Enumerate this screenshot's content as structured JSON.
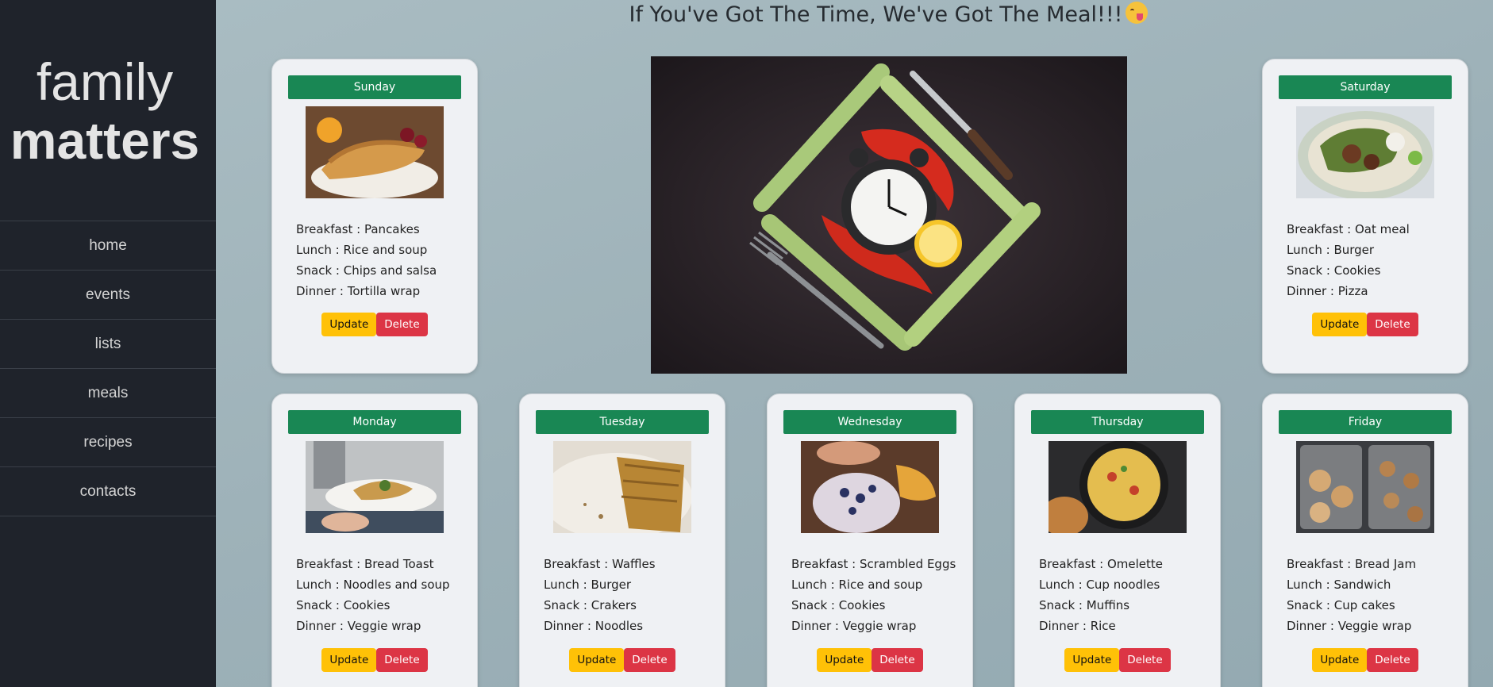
{
  "logo": {
    "line1": "family",
    "line2": "matters"
  },
  "nav": [
    "home",
    "events",
    "lists",
    "meals",
    "recipes",
    "contacts"
  ],
  "headline": "If You've Got The Time, We've Got The Meal!!!",
  "buttons": {
    "update": "Update",
    "delete": "Delete"
  },
  "days": [
    {
      "day": "Sunday",
      "image": "pancakes-photo",
      "breakfast": "Breakfast : Pancakes",
      "lunch": "Lunch : Rice and soup",
      "snack": "Snack : Chips and salsa",
      "dinner": "Dinner : Tortilla wrap"
    },
    {
      "day": "Saturday",
      "image": "oatmeal-bowl-photo",
      "breakfast": "Breakfast : Oat meal",
      "lunch": "Lunch : Burger",
      "snack": "Snack : Cookies",
      "dinner": "Dinner : Pizza"
    },
    {
      "day": "Monday",
      "image": "toast-plate-photo",
      "breakfast": "Breakfast : Bread Toast",
      "lunch": "Lunch : Noodles and soup",
      "snack": "Snack : Cookies",
      "dinner": "Dinner : Veggie wrap"
    },
    {
      "day": "Tuesday",
      "image": "waffles-photo",
      "breakfast": "Breakfast : Waffles",
      "lunch": "Lunch : Burger",
      "snack": "Snack : Crakers",
      "dinner": "Dinner : Noodles"
    },
    {
      "day": "Wednesday",
      "image": "breakfast-table-photo",
      "breakfast": "Breakfast : Scrambled Eggs",
      "lunch": "Lunch : Rice and soup",
      "snack": "Snack : Cookies",
      "dinner": "Dinner : Veggie wrap"
    },
    {
      "day": "Thursday",
      "image": "omelette-pan-photo",
      "breakfast": "Breakfast : Omelette",
      "lunch": "Lunch : Cup noodles",
      "snack": "Snack : Muffins",
      "dinner": "Dinner : Rice"
    },
    {
      "day": "Friday",
      "image": "cookies-tray-photo",
      "breakfast": "Breakfast : Bread Jam",
      "lunch": "Lunch : Sandwich",
      "snack": "Snack : Cup cakes",
      "dinner": "Dinner : Veggie wrap"
    }
  ],
  "colors": {
    "sidebar": "#1f232b",
    "badge": "#198754",
    "update": "#ffc107",
    "delete": "#dc3545",
    "card": "#eff1f4"
  }
}
